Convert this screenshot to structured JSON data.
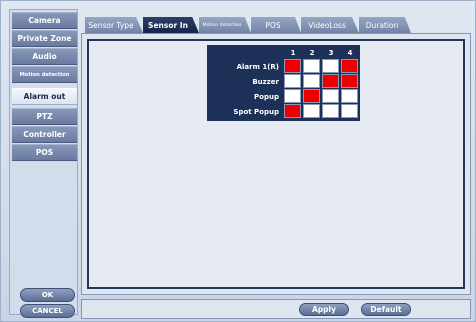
{
  "sidebar": {
    "items": [
      {
        "label": "Camera"
      },
      {
        "label": "Private Zone"
      },
      {
        "label": "Audio"
      },
      {
        "label": "Motion detection"
      },
      {
        "label": "Alarm out"
      },
      {
        "label": "PTZ"
      },
      {
        "label": "Controller"
      },
      {
        "label": "POS"
      }
    ],
    "active_index": 4,
    "ok_label": "OK",
    "cancel_label": "CANCEL"
  },
  "tabs": [
    {
      "label": "Sensor Type"
    },
    {
      "label": "Sensor In"
    },
    {
      "label": "Motion detection"
    },
    {
      "label": "POS"
    },
    {
      "label": "VideoLoss"
    },
    {
      "label": "Duration"
    }
  ],
  "active_tab_index": 1,
  "grid": {
    "columns": [
      "1",
      "2",
      "3",
      "4"
    ],
    "rows": [
      {
        "label": "Alarm 1(R)",
        "values": [
          true,
          false,
          false,
          true
        ]
      },
      {
        "label": "Buzzer",
        "values": [
          false,
          false,
          true,
          true
        ]
      },
      {
        "label": "Popup",
        "values": [
          false,
          true,
          false,
          false
        ]
      },
      {
        "label": "Spot Popup",
        "values": [
          true,
          false,
          false,
          false
        ]
      }
    ],
    "on_color": "#ee0000",
    "off_color": "#ffffff"
  },
  "footer": {
    "apply_label": "Apply",
    "default_label": "Default"
  }
}
